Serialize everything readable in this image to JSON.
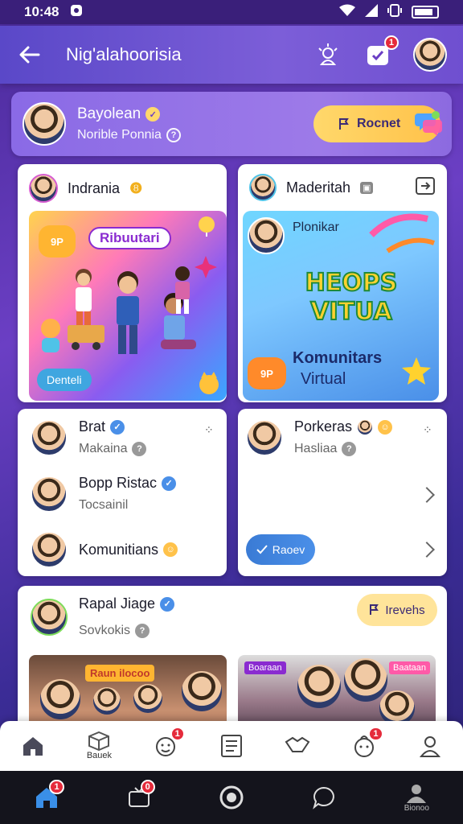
{
  "status_bar": {
    "time": "10:48"
  },
  "app_bar": {
    "title": "Nig'alаhoorisia"
  },
  "notifications": {
    "count": "1"
  },
  "profile": {
    "name": "Bayolean",
    "subtitle": "Norible Ponnia",
    "action_label": "Rocnet"
  },
  "cards": [
    {
      "author": "Indrania",
      "banner_title": "Ribuutari",
      "banner_badge": "9P",
      "banner_button": "Denteli"
    },
    {
      "author": "Maderitah",
      "banner_small": "Plonikar",
      "banner_big_1": "HEOPS",
      "banner_big_2": "VITUA",
      "banner_sub_1": "Komunitars",
      "banner_sub_2": "Virtual",
      "banner_badge": "9P"
    }
  ],
  "left_list": [
    {
      "name": "Brat",
      "sub": "Makaina"
    },
    {
      "name": "Bopp Ristac",
      "sub": "Tocsainil"
    },
    {
      "name": "Komunitians",
      "sub": ""
    }
  ],
  "right_list": {
    "name": "Porkeras",
    "sub": "Hasliaa",
    "button": "Raoev"
  },
  "feed_post": {
    "name": "Rapal Jiage",
    "sub": "Sovkokis",
    "action": "Irevehs",
    "photo_left_sign": "Raun ilocoo",
    "photo_right_sign_1": "Boaraan",
    "photo_right_sign_2": "Baataan"
  },
  "bottom_tabs": [
    {
      "label": "",
      "icon": "home-icon"
    },
    {
      "label": "Bauek",
      "icon": "box-icon"
    },
    {
      "label": "",
      "icon": "kid-face-icon",
      "badge": "1"
    },
    {
      "label": "",
      "icon": "document-icon"
    },
    {
      "label": "",
      "icon": "handshake-icon"
    },
    {
      "label": "",
      "icon": "baby-icon",
      "badge": "1"
    },
    {
      "label": "",
      "icon": "person-icon"
    }
  ],
  "nav_bar": [
    {
      "label": "",
      "icon": "home-icon",
      "badge": "1"
    },
    {
      "label": "",
      "icon": "tv-icon",
      "badge": "0"
    },
    {
      "label": "",
      "icon": "record-icon"
    },
    {
      "label": "",
      "icon": "chat-icon"
    },
    {
      "label": "Bionoo",
      "icon": "profile-icon"
    }
  ],
  "colors": {
    "accent": "#6b3fc4",
    "yellow": "#ffc24a",
    "blue_button": "#3a7bd5",
    "badge": "#e52b3b"
  }
}
